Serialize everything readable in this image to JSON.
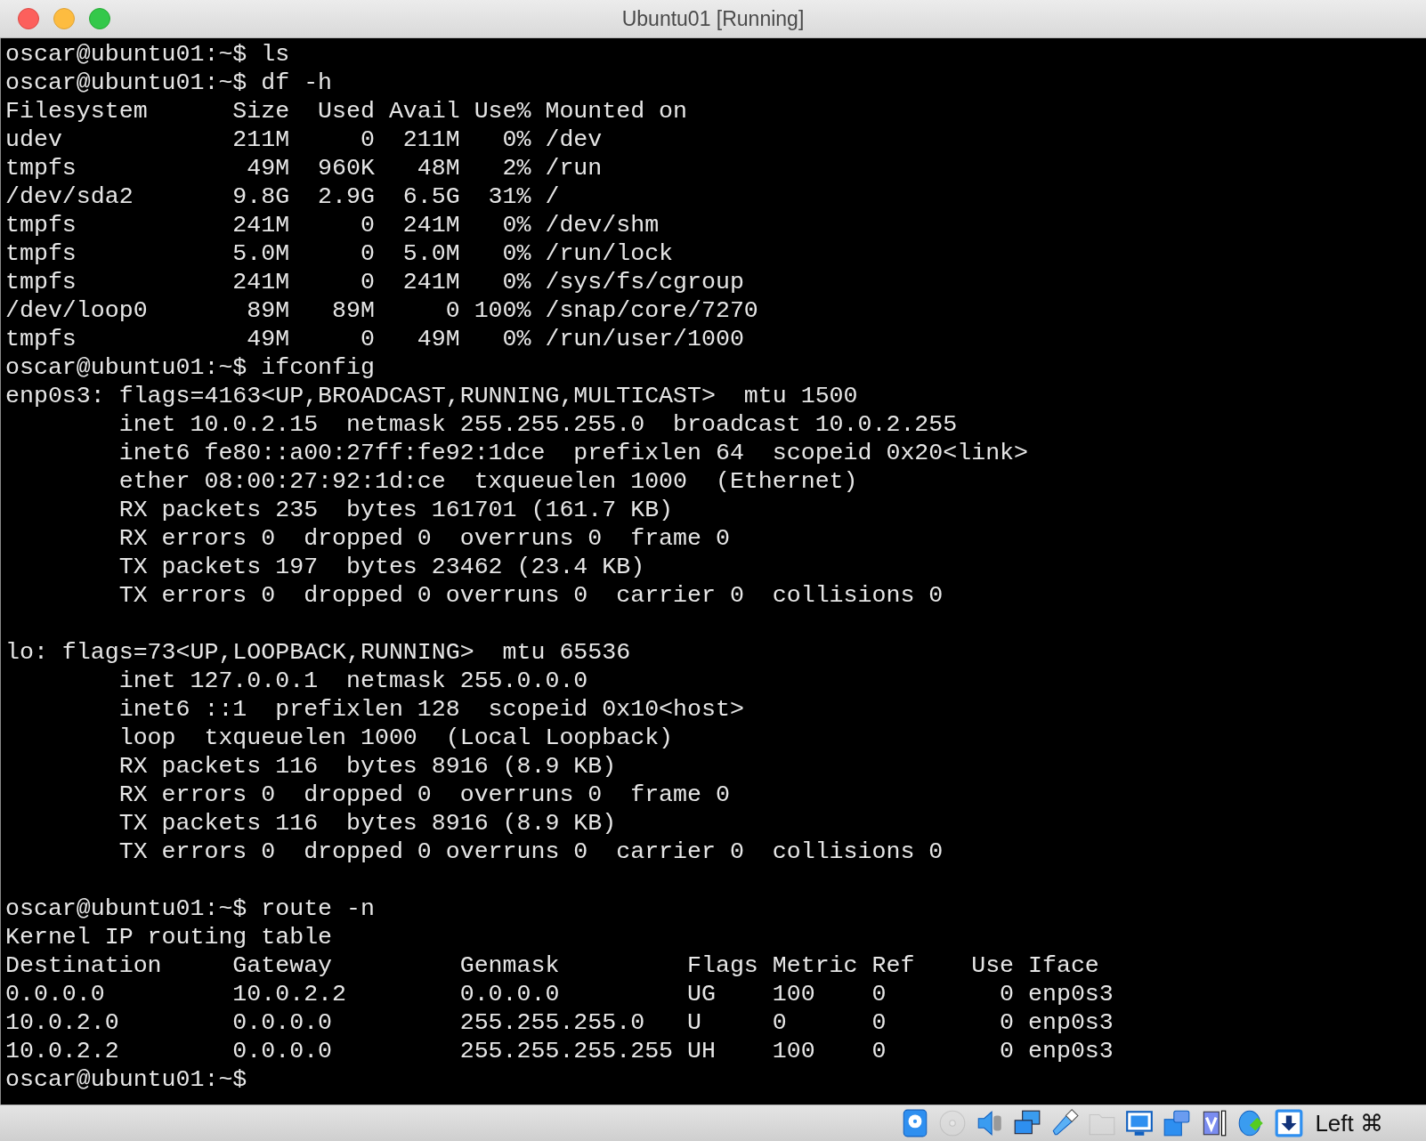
{
  "window": {
    "title": "Ubuntu01 [Running]"
  },
  "terminal": {
    "lines": [
      {
        "kind": "text",
        "text": "oscar@ubuntu01:~$ ls"
      },
      {
        "kind": "text",
        "text": "oscar@ubuntu01:~$ df -h"
      },
      {
        "kind": "text",
        "text": "Filesystem      Size  Used Avail Use% Mounted on"
      },
      {
        "kind": "text",
        "text": "udev            211M     0  211M   0% /dev"
      },
      {
        "kind": "text",
        "text": "tmpfs            49M  960K   48M   2% /run"
      },
      {
        "kind": "text",
        "text": "/dev/sda2       9.8G  2.9G  6.5G  31% /"
      },
      {
        "kind": "text",
        "text": "tmpfs           241M     0  241M   0% /dev/shm"
      },
      {
        "kind": "text",
        "text": "tmpfs           5.0M     0  5.0M   0% /run/lock"
      },
      {
        "kind": "text",
        "text": "tmpfs           241M     0  241M   0% /sys/fs/cgroup"
      },
      {
        "kind": "text",
        "text": "/dev/loop0       89M   89M     0 100% /snap/core/7270"
      },
      {
        "kind": "text",
        "text": "tmpfs            49M     0   49M   0% /run/user/1000"
      },
      {
        "kind": "text",
        "text": "oscar@ubuntu01:~$ ifconfig"
      },
      {
        "kind": "text",
        "text": "enp0s3: flags=4163<UP,BROADCAST,RUNNING,MULTICAST>  mtu 1500"
      },
      {
        "kind": "text",
        "text": "        inet 10.0.2.15  netmask 255.255.255.0  broadcast 10.0.2.255"
      },
      {
        "kind": "text",
        "text": "        inet6 fe80::a00:27ff:fe92:1dce  prefixlen 64  scopeid 0x20<link>"
      },
      {
        "kind": "text",
        "text": "        ether 08:00:27:92:1d:ce  txqueuelen 1000  (Ethernet)"
      },
      {
        "kind": "text",
        "text": "        RX packets 235  bytes 161701 (161.7 KB)"
      },
      {
        "kind": "text",
        "text": "        RX errors 0  dropped 0  overruns 0  frame 0"
      },
      {
        "kind": "text",
        "text": "        TX packets 197  bytes 23462 (23.4 KB)"
      },
      {
        "kind": "text",
        "text": "        TX errors 0  dropped 0 overruns 0  carrier 0  collisions 0"
      },
      {
        "kind": "blank"
      },
      {
        "kind": "text",
        "text": "lo: flags=73<UP,LOOPBACK,RUNNING>  mtu 65536"
      },
      {
        "kind": "text",
        "text": "        inet 127.0.0.1  netmask 255.0.0.0"
      },
      {
        "kind": "text",
        "text": "        inet6 ::1  prefixlen 128  scopeid 0x10<host>"
      },
      {
        "kind": "text",
        "text": "        loop  txqueuelen 1000  (Local Loopback)"
      },
      {
        "kind": "text",
        "text": "        RX packets 116  bytes 8916 (8.9 KB)"
      },
      {
        "kind": "text",
        "text": "        RX errors 0  dropped 0  overruns 0  frame 0"
      },
      {
        "kind": "text",
        "text": "        TX packets 116  bytes 8916 (8.9 KB)"
      },
      {
        "kind": "text",
        "text": "        TX errors 0  dropped 0 overruns 0  carrier 0  collisions 0"
      },
      {
        "kind": "blank"
      },
      {
        "kind": "text",
        "text": "oscar@ubuntu01:~$ route -n"
      },
      {
        "kind": "text",
        "text": "Kernel IP routing table"
      },
      {
        "kind": "text",
        "text": "Destination     Gateway         Genmask         Flags Metric Ref    Use Iface"
      },
      {
        "kind": "text",
        "text": "0.0.0.0         10.0.2.2        0.0.0.0         UG    100    0        0 enp0s3"
      },
      {
        "kind": "text",
        "text": "10.0.2.0        0.0.0.0         255.255.255.0   U     0      0        0 enp0s3"
      },
      {
        "kind": "text",
        "text": "10.0.2.2        0.0.0.0         255.255.255.255 UH    100    0        0 enp0s3"
      },
      {
        "kind": "text",
        "text": "oscar@ubuntu01:~$"
      }
    ]
  },
  "status_bar": {
    "icons": [
      {
        "kind": "disk",
        "disabled": false
      },
      {
        "kind": "optical",
        "disabled": true
      },
      {
        "kind": "audio",
        "disabled": false
      },
      {
        "kind": "network",
        "disabled": false
      },
      {
        "kind": "usb",
        "disabled": false
      },
      {
        "kind": "folder",
        "disabled": true
      },
      {
        "kind": "display",
        "disabled": false
      },
      {
        "kind": "capture",
        "disabled": false
      },
      {
        "kind": "cpu",
        "disabled": false
      },
      {
        "kind": "mouse",
        "disabled": false
      },
      {
        "kind": "keyboard",
        "disabled": false
      }
    ],
    "host_key": "Left ⌘"
  }
}
